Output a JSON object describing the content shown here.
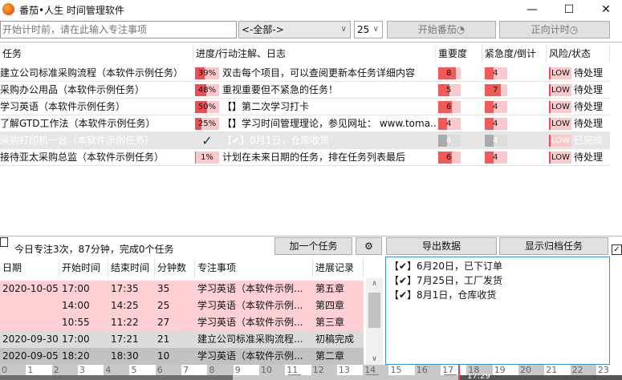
{
  "window": {
    "title": "番茄•人生 时间管理软件",
    "min": "—",
    "max": "☐",
    "close": "✕"
  },
  "toolbar": {
    "focus_placeholder": "开始计时前，请在此输入专注事项",
    "category": "<-全部->",
    "minutes": "25",
    "start_label": "开始番茄",
    "count_up_label": "正向计时"
  },
  "tasks": {
    "headers": [
      "任务",
      "进度/行动注解、日志",
      "重要度",
      "紧急度/倒计",
      "风险/状态"
    ],
    "rows": [
      {
        "name": "建立公司标准采购流程（本软件示例任务）",
        "progress": "39%",
        "progress_value": 39,
        "note": "双击每个项目，可以查阅更新本任务详细内容",
        "importance": "8",
        "importance_value": 8,
        "urgency": "4",
        "urgency_value": 4,
        "risk": "LOW",
        "status": "待处理",
        "done": false
      },
      {
        "name": "采购办公用品（本软件示例任务）",
        "progress": "48%",
        "progress_value": 48,
        "note": "重视重要但不紧急的任务！",
        "importance": "5",
        "importance_value": 5,
        "urgency": "7",
        "urgency_value": 7,
        "risk": "LOW",
        "status": "待处理",
        "done": false
      },
      {
        "name": "学习英语（本软件示例任务）",
        "progress": "50%",
        "progress_value": 50,
        "note": "【】第二次学习打卡",
        "importance": "6",
        "importance_value": 6,
        "urgency": "4",
        "urgency_value": 4,
        "risk": "LOW",
        "status": "待处理",
        "done": false
      },
      {
        "name": "了解GTD工作法（本软件示例任务）",
        "progress": "25%",
        "progress_value": 25,
        "note": "【】学习时间管理理论，参见网址： www.toma...",
        "importance": "4",
        "importance_value": 4,
        "urgency": "4",
        "urgency_value": 4,
        "risk": "LOW",
        "status": "待处理",
        "done": false
      },
      {
        "name": "采购打印机一台（本软件示例任务）",
        "progress": "✓",
        "progress_value": 100,
        "note": "【✔】8月1日，仓库收货",
        "importance": "4",
        "importance_value": 4,
        "urgency": "4",
        "urgency_value": 4,
        "risk": "LOW",
        "status": "已完成",
        "done": true
      },
      {
        "name": "接待亚太采购总监（本软件示例任务）",
        "progress": "1%",
        "progress_value": 1,
        "note": "计划在未来日期的任务，排在任务列表最后",
        "importance": "6",
        "importance_value": 6,
        "urgency": "4",
        "urgency_value": 4,
        "risk": "LOW",
        "status": "待处理",
        "done": false
      }
    ]
  },
  "summary": "今日专注3次，87分钟，完成0个任务",
  "buttons": {
    "add_task": "加一个任务",
    "export": "导出数据",
    "show_archived": "显示归档任务"
  },
  "log": {
    "headers": [
      "日期",
      "开始时间",
      "结束时间",
      "分钟数",
      "专注事项",
      "进展记录"
    ],
    "rows": [
      {
        "date": "2020-10-05",
        "start": "17:00",
        "end": "17:35",
        "minutes": "35",
        "item": "学习英语（本软件示例...",
        "record": "第五章",
        "tone": "pink"
      },
      {
        "date": "",
        "start": "14:00",
        "end": "14:25",
        "minutes": "25",
        "item": "学习英语（本软件示例...",
        "record": "第四章",
        "tone": "pink"
      },
      {
        "date": "",
        "start": "10:55",
        "end": "11:22",
        "minutes": "27",
        "item": "学习英语（本软件示例...",
        "record": "第三章",
        "tone": "pink"
      },
      {
        "date": "2020-09-30",
        "start": "17:00",
        "end": "17:21",
        "minutes": "21",
        "item": "建立公司标准采购流程...",
        "record": "初稿完成",
        "tone": "gray"
      },
      {
        "date": "2020-09-05",
        "start": "18:20",
        "end": "18:30",
        "minutes": "10",
        "item": "学习英语（本软件示例...",
        "record": "第二章",
        "tone": "dgray"
      }
    ]
  },
  "notes": [
    "【✔】6月20日，已下订单",
    "【✔】7月25日，工厂发货",
    "【✔】8月1日，仓库收货"
  ],
  "timeline": {
    "hours": [
      "0",
      "1",
      "2",
      "3",
      "4",
      "5",
      "6",
      "7",
      "8",
      "9",
      "10",
      "11",
      "12",
      "13",
      "14",
      "15",
      "16",
      "17",
      "18",
      "19",
      "20",
      "21",
      "22",
      "23"
    ],
    "focus_hours": [
      11,
      14,
      17
    ],
    "current_time": "17:29"
  }
}
